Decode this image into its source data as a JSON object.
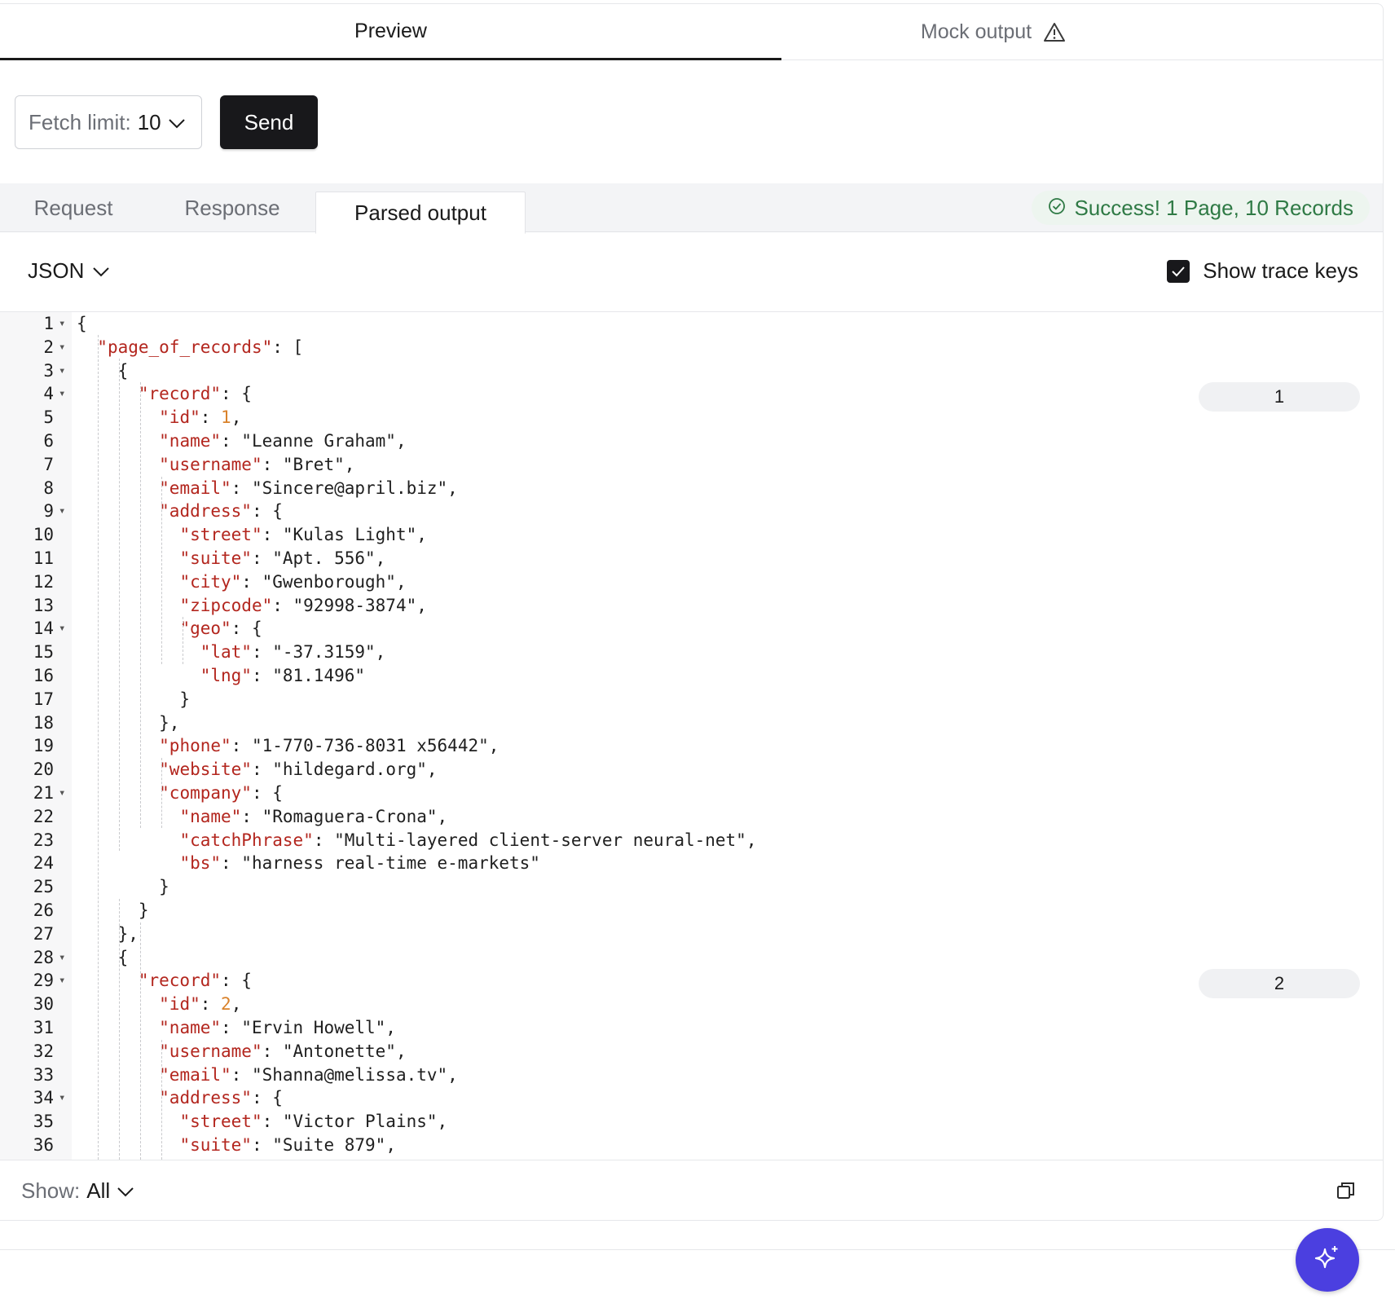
{
  "top_tabs": {
    "preview": "Preview",
    "mock_output": "Mock output"
  },
  "controls": {
    "fetch_label": "Fetch limit:",
    "fetch_value": "10",
    "send_label": "Send"
  },
  "subtabs": {
    "request": "Request",
    "response": "Response",
    "parsed": "Parsed output"
  },
  "status": "Success! 1 Page, 10 Records",
  "toolbar": {
    "format": "JSON",
    "trace_label": "Show trace keys",
    "trace_checked": true
  },
  "record_badges": [
    "1",
    "2"
  ],
  "code_lines": [
    {
      "n": "1",
      "fold": true,
      "html": "{"
    },
    {
      "n": "2",
      "fold": true,
      "html": "  <span class=\"k\">\"page_of_records\"</span>: ["
    },
    {
      "n": "3",
      "fold": true,
      "html": "    {"
    },
    {
      "n": "4",
      "fold": true,
      "html": "      <span class=\"k\">\"record\"</span>: {"
    },
    {
      "n": "5",
      "fold": false,
      "html": "        <span class=\"k\">\"id\"</span>: <span class=\"n\">1</span>,"
    },
    {
      "n": "6",
      "fold": false,
      "html": "        <span class=\"k\">\"name\"</span>: \"Leanne Graham\","
    },
    {
      "n": "7",
      "fold": false,
      "html": "        <span class=\"k\">\"username\"</span>: \"Bret\","
    },
    {
      "n": "8",
      "fold": false,
      "html": "        <span class=\"k\">\"email\"</span>: \"Sincere@april.biz\","
    },
    {
      "n": "9",
      "fold": true,
      "html": "        <span class=\"k\">\"address\"</span>: {"
    },
    {
      "n": "10",
      "fold": false,
      "html": "          <span class=\"k\">\"street\"</span>: \"Kulas Light\","
    },
    {
      "n": "11",
      "fold": false,
      "html": "          <span class=\"k\">\"suite\"</span>: \"Apt. 556\","
    },
    {
      "n": "12",
      "fold": false,
      "html": "          <span class=\"k\">\"city\"</span>: \"Gwenborough\","
    },
    {
      "n": "13",
      "fold": false,
      "html": "          <span class=\"k\">\"zipcode\"</span>: \"92998-3874\","
    },
    {
      "n": "14",
      "fold": true,
      "html": "          <span class=\"k\">\"geo\"</span>: {"
    },
    {
      "n": "15",
      "fold": false,
      "html": "            <span class=\"k\">\"lat\"</span>: \"-37.3159\","
    },
    {
      "n": "16",
      "fold": false,
      "html": "            <span class=\"k\">\"lng\"</span>: \"81.1496\""
    },
    {
      "n": "17",
      "fold": false,
      "html": "          }"
    },
    {
      "n": "18",
      "fold": false,
      "html": "        },"
    },
    {
      "n": "19",
      "fold": false,
      "html": "        <span class=\"k\">\"phone\"</span>: \"1-770-736-8031 x56442\","
    },
    {
      "n": "20",
      "fold": false,
      "html": "        <span class=\"k\">\"website\"</span>: \"hildegard.org\","
    },
    {
      "n": "21",
      "fold": true,
      "html": "        <span class=\"k\">\"company\"</span>: {"
    },
    {
      "n": "22",
      "fold": false,
      "html": "          <span class=\"k\">\"name\"</span>: \"Romaguera-Crona\","
    },
    {
      "n": "23",
      "fold": false,
      "html": "          <span class=\"k\">\"catchPhrase\"</span>: \"Multi-layered client-server neural-net\","
    },
    {
      "n": "24",
      "fold": false,
      "html": "          <span class=\"k\">\"bs\"</span>: \"harness real-time e-markets\""
    },
    {
      "n": "25",
      "fold": false,
      "html": "        }"
    },
    {
      "n": "26",
      "fold": false,
      "html": "      }"
    },
    {
      "n": "27",
      "fold": false,
      "html": "    },"
    },
    {
      "n": "28",
      "fold": true,
      "html": "    {"
    },
    {
      "n": "29",
      "fold": true,
      "html": "      <span class=\"k\">\"record\"</span>: {"
    },
    {
      "n": "30",
      "fold": false,
      "html": "        <span class=\"k\">\"id\"</span>: <span class=\"n\">2</span>,"
    },
    {
      "n": "31",
      "fold": false,
      "html": "        <span class=\"k\">\"name\"</span>: \"Ervin Howell\","
    },
    {
      "n": "32",
      "fold": false,
      "html": "        <span class=\"k\">\"username\"</span>: \"Antonette\","
    },
    {
      "n": "33",
      "fold": false,
      "html": "        <span class=\"k\">\"email\"</span>: \"Shanna@melissa.tv\","
    },
    {
      "n": "34",
      "fold": true,
      "html": "        <span class=\"k\">\"address\"</span>: {"
    },
    {
      "n": "35",
      "fold": false,
      "html": "          <span class=\"k\">\"street\"</span>: \"Victor Plains\","
    },
    {
      "n": "36",
      "fold": false,
      "html": "          <span class=\"k\">\"suite\"</span>: \"Suite 879\","
    }
  ],
  "footer": {
    "show_label": "Show:",
    "show_value": "All"
  },
  "colors": {
    "accent": "#4b3fe0",
    "success": "#2f7a45",
    "json_key": "#b3261e",
    "json_number": "#d9822b"
  }
}
